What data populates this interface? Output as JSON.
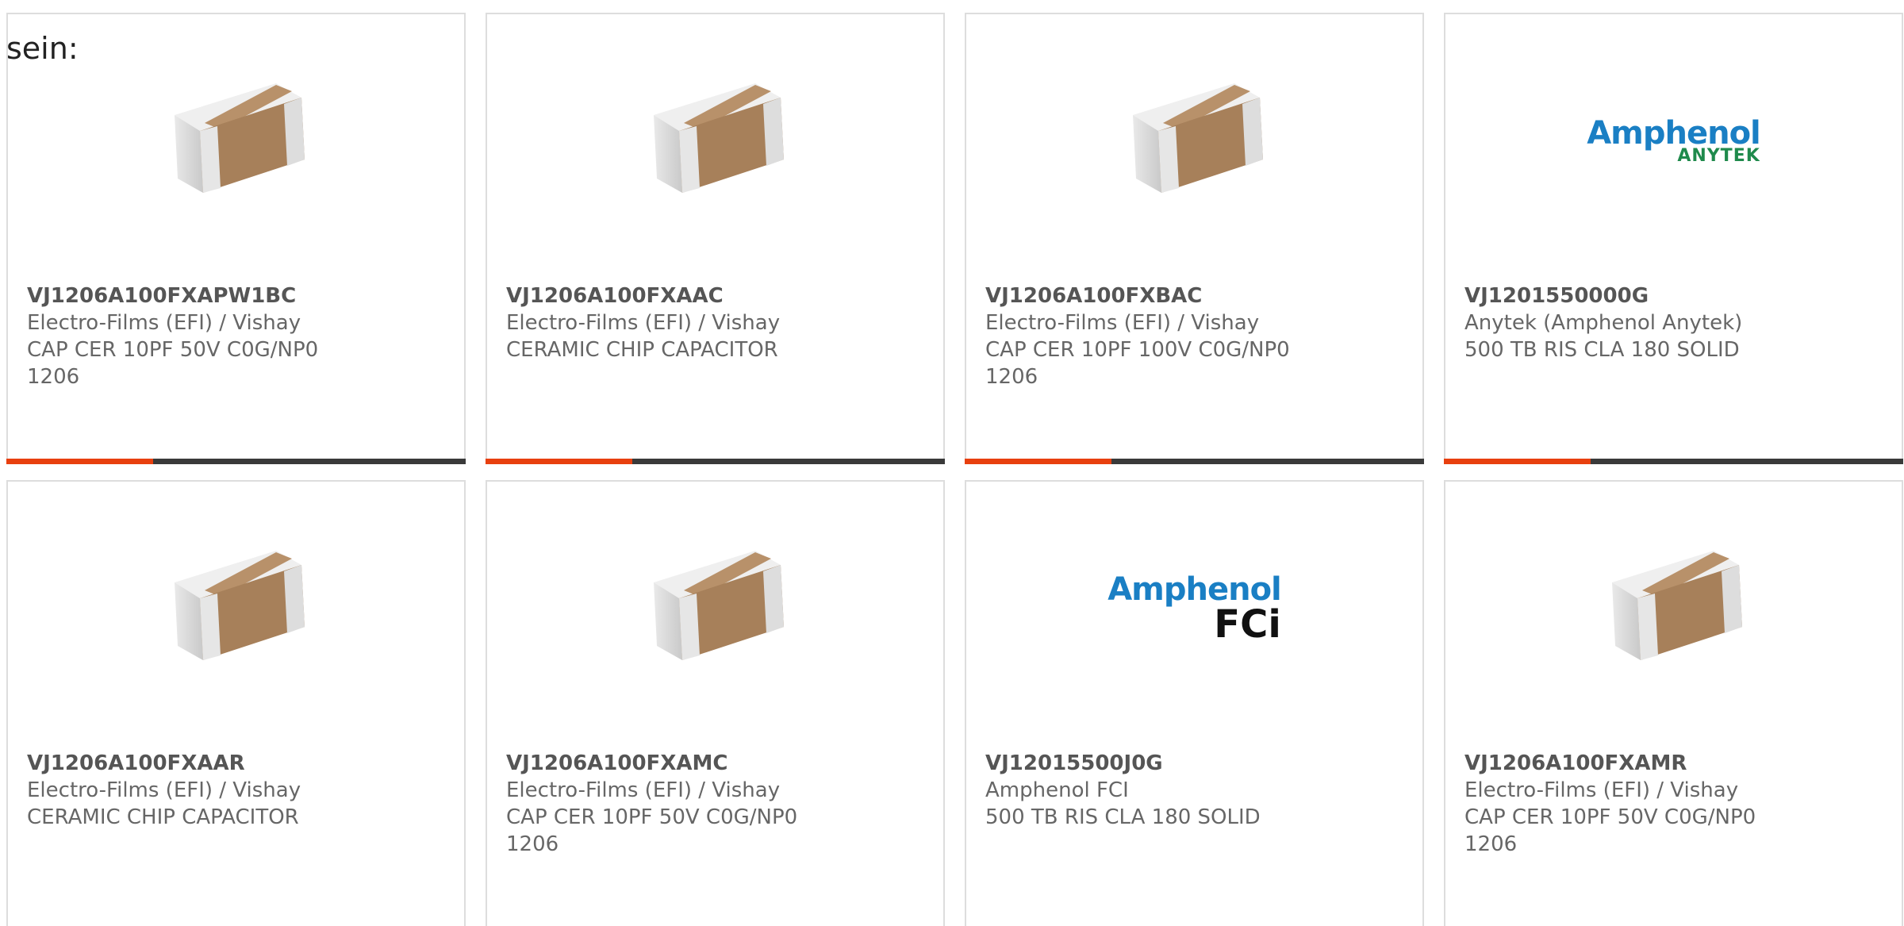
{
  "intro_text": "sein:",
  "colors": {
    "accent": "#e8400f",
    "bar_track": "#3a3a3a",
    "card_border": "#dddddd",
    "text_muted": "#666666",
    "amphenol_blue": "#1a7fc4",
    "anytek_green": "#1f8a4c"
  },
  "products": [
    {
      "image": "ceramic-chip-capacitor",
      "part_number": "VJ1206A100FXAPW1BC",
      "manufacturer": "Electro-Films (EFI) / Vishay",
      "desc_line1": "CAP CER 10PF 50V C0G/NP0",
      "desc_line2": "1206",
      "progress": 0.32
    },
    {
      "image": "ceramic-chip-capacitor",
      "part_number": "VJ1206A100FXAAC",
      "manufacturer": "Electro-Films (EFI) / Vishay",
      "desc_line1": "CERAMIC CHIP CAPACITOR",
      "desc_line2": "",
      "progress": 0.32
    },
    {
      "image": "ceramic-chip-capacitor",
      "part_number": "VJ1206A100FXBAC",
      "manufacturer": "Electro-Films (EFI) / Vishay",
      "desc_line1": "CAP CER 10PF 100V C0G/NP0",
      "desc_line2": "1206",
      "progress": 0.32
    },
    {
      "image": "amphenol-anytek-logo",
      "logo_main": "Amphenol",
      "logo_sub": "ANYTEK",
      "part_number": "VJ1201550000G",
      "manufacturer": "Anytek (Amphenol Anytek)",
      "desc_line1": "500 TB RIS CLA 180 SOLID",
      "desc_line2": "",
      "progress": 0.32
    },
    {
      "image": "ceramic-chip-capacitor",
      "part_number": "VJ1206A100FXAAR",
      "manufacturer": "Electro-Films (EFI) / Vishay",
      "desc_line1": "CERAMIC CHIP CAPACITOR",
      "desc_line2": ""
    },
    {
      "image": "ceramic-chip-capacitor",
      "part_number": "VJ1206A100FXAMC",
      "manufacturer": "Electro-Films (EFI) / Vishay",
      "desc_line1": "CAP CER 10PF 50V C0G/NP0",
      "desc_line2": "1206"
    },
    {
      "image": "amphenol-fci-logo",
      "logo_main": "Amphenol",
      "logo_sub": "FCi",
      "part_number": "VJ12015500J0G",
      "manufacturer": "Amphenol FCI",
      "desc_line1": "500 TB RIS CLA 180 SOLID",
      "desc_line2": ""
    },
    {
      "image": "ceramic-chip-capacitor",
      "part_number": "VJ1206A100FXAMR",
      "manufacturer": "Electro-Films (EFI) / Vishay",
      "desc_line1": "CAP CER 10PF 50V C0G/NP0",
      "desc_line2": "1206"
    }
  ]
}
